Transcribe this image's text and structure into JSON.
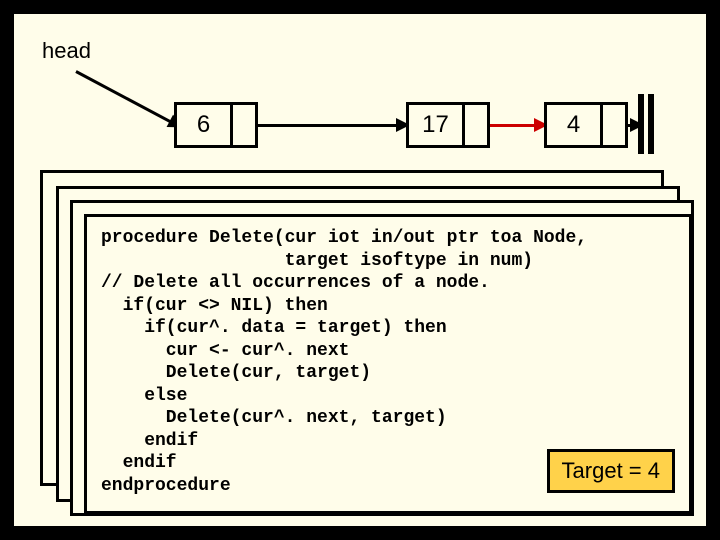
{
  "head_label": "head",
  "nodes": {
    "n1": "6",
    "n2": "17",
    "n3": "4"
  },
  "code": {
    "l1": "procedure Delete(cur iot in/out ptr toa Node,",
    "l2": "                 target isoftype in num)",
    "l3": "// Delete all occurrences of a node.",
    "l4": "  if(cur <> NIL) then",
    "l5": "    if(cur^. data = target) then",
    "l6": "      cur <- cur^. next",
    "l7": "      Delete(cur, target)",
    "l8": "    else",
    "l9": "      Delete(cur^. next, target)",
    "l10": "    endif",
    "l11": "  endif",
    "l12": "endprocedure"
  },
  "target_box": "Target = 4",
  "domain": "Diagram"
}
